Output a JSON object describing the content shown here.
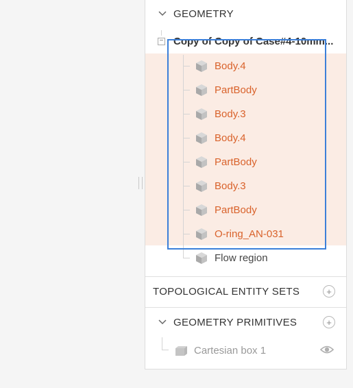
{
  "geometry": {
    "title": "GEOMETRY",
    "root_label": "Copy of Copy of Case#4-10mm...",
    "items": [
      {
        "label": "Body.4",
        "highlighted": true
      },
      {
        "label": "PartBody",
        "highlighted": true
      },
      {
        "label": "Body.3",
        "highlighted": true
      },
      {
        "label": "Body.4",
        "highlighted": true
      },
      {
        "label": "PartBody",
        "highlighted": true
      },
      {
        "label": "Body.3",
        "highlighted": true
      },
      {
        "label": "PartBody",
        "highlighted": true
      },
      {
        "label": "O-ring_AN-031",
        "highlighted": true
      },
      {
        "label": "Flow region",
        "highlighted": false
      }
    ]
  },
  "topological_entity_sets": {
    "title": "TOPOLOGICAL ENTITY SETS",
    "add_icon": "plus-icon"
  },
  "geometry_primitives": {
    "title": "GEOMETRY PRIMITIVES",
    "add_icon": "plus-icon",
    "items": [
      {
        "label": "Cartesian box 1",
        "visibility_icon": "eye-icon"
      }
    ]
  },
  "colors": {
    "highlight_text": "#d9622b",
    "highlight_bg": "#fbece4",
    "selection_border": "#3b7fd9"
  }
}
